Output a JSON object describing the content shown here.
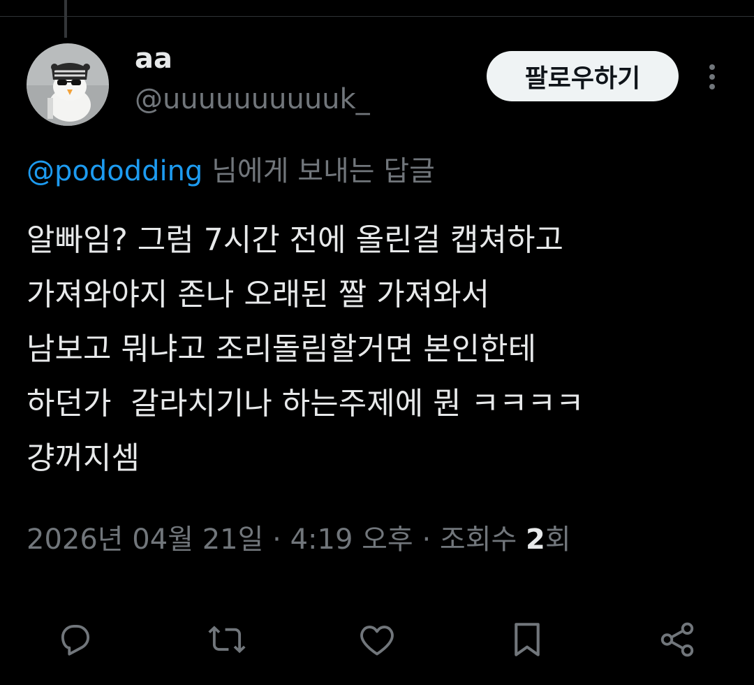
{
  "tweet": {
    "author": {
      "display_name": "aa",
      "handle": "@uuuuuuuuuuk_"
    },
    "follow_label": "팔로우하기",
    "reply_to": {
      "mention": "@pododding",
      "suffix": " 님에게 보내는 답글"
    },
    "text_lines": [
      "알빠임? 그럼 7시간 전에 올린걸 캡쳐하고",
      "가져와야지 존나 오래된 짤 가져와서",
      "남보고 뭐냐고 조리돌림할거면 본인한테",
      "하던가  갈라치기나 하는주제에 뭔 ㅋㅋㅋㅋ",
      "걍꺼지셈"
    ],
    "meta": {
      "date": "2026년 04월 21일",
      "separator_1": " · ",
      "time": "4:19 오후",
      "separator_2": " · ",
      "views_label": "조회수 ",
      "views_count": "2",
      "views_unit": "회"
    }
  },
  "icons": {
    "more": "more-vertical-icon",
    "reply": "reply-icon",
    "retweet": "retweet-icon",
    "like": "heart-icon",
    "bookmark": "bookmark-icon",
    "share": "share-icon"
  },
  "colors": {
    "background": "#000000",
    "text_primary": "#e7e9ea",
    "text_secondary": "#71767b",
    "accent": "#1d9bf0",
    "follow_button_bg": "#eff3f4"
  }
}
